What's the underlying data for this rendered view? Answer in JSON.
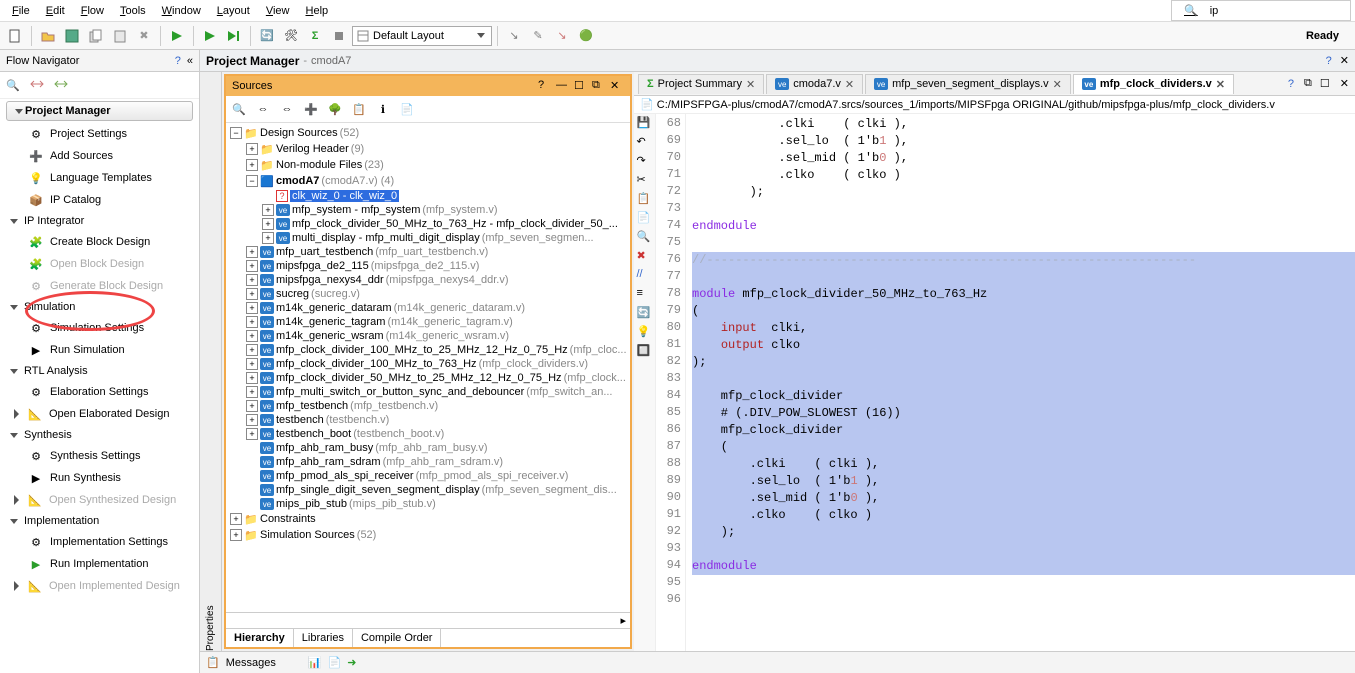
{
  "menu": {
    "items": [
      "File",
      "Edit",
      "Flow",
      "Tools",
      "Window",
      "Layout",
      "View",
      "Help"
    ]
  },
  "search": {
    "placeholder": "",
    "value": "ip"
  },
  "toolbar": {
    "layout_label": "Default Layout",
    "status": "Ready"
  },
  "flow_nav": {
    "title": "Flow Navigator",
    "pm": "Project Manager",
    "pm_items": [
      "Project Settings",
      "Add Sources",
      "Language Templates",
      "IP Catalog"
    ],
    "ip": "IP Integrator",
    "ip_items": [
      "Create Block Design",
      "Open Block Design",
      "Generate Block Design"
    ],
    "sim": "Simulation",
    "sim_items": [
      "Simulation Settings",
      "Run Simulation"
    ],
    "rtl": "RTL Analysis",
    "rtl_items": [
      "Elaboration Settings",
      "Open Elaborated Design"
    ],
    "syn": "Synthesis",
    "syn_items": [
      "Synthesis Settings",
      "Run Synthesis",
      "Open Synthesized Design"
    ],
    "impl": "Implementation",
    "impl_items": [
      "Implementation Settings",
      "Run Implementation",
      "Open Implemented Design"
    ]
  },
  "pm_header": {
    "title": "Project Manager",
    "project": "cmodA7"
  },
  "properties_tab": "Properties",
  "sources": {
    "title": "Sources",
    "bottom_tabs": [
      "Hierarchy",
      "Libraries",
      "Compile Order"
    ],
    "tree": {
      "design_sources": "Design Sources",
      "design_sources_count": "(52)",
      "verilog_header": "Verilog Header",
      "verilog_header_count": "(9)",
      "non_module": "Non-module Files",
      "non_module_count": "(23)",
      "cmodA7": "cmodA7",
      "cmodA7_paren": "(cmodA7.v) (4)",
      "clk_wiz": "clk_wiz_0 - clk_wiz_0",
      "mfp_system": "mfp_system - mfp_system",
      "mfp_system_paren": "(mfp_system.v)",
      "mfp_clock_div": "mfp_clock_divider_50_MHz_to_763_Hz - mfp_clock_divider_50_...",
      "multi_display": "multi_display - mfp_multi_digit_display",
      "multi_display_paren": "(mfp_seven_segmen...",
      "uart_tb": "mfp_uart_testbench",
      "uart_tb_paren": "(mfp_uart_testbench.v)",
      "de2": "mipsfpga_de2_115",
      "de2_paren": "(mipsfpga_de2_115.v)",
      "nexys4": "mipsfpga_nexys4_ddr",
      "nexys4_paren": "(mipsfpga_nexys4_ddr.v)",
      "sucreg": "sucreg",
      "sucreg_paren": "(sucreg.v)",
      "dataram": "m14k_generic_dataram",
      "dataram_paren": "(m14k_generic_dataram.v)",
      "tagram": "m14k_generic_tagram",
      "tagram_paren": "(m14k_generic_tagram.v)",
      "wsram": "m14k_generic_wsram",
      "wsram_paren": "(m14k_generic_wsram.v)",
      "clk100_25": "mfp_clock_divider_100_MHz_to_25_MHz_12_Hz_0_75_Hz",
      "clk100_25_paren": "(mfp_cloc...",
      "clk100_763": "mfp_clock_divider_100_MHz_to_763_Hz",
      "clk100_763_paren": "(mfp_clock_dividers.v)",
      "clk50_25": "mfp_clock_divider_50_MHz_to_25_MHz_12_Hz_0_75_Hz",
      "clk50_25_paren": "(mfp_clock...",
      "switch": "mfp_multi_switch_or_button_sync_and_debouncer",
      "switch_paren": "(mfp_switch_an...",
      "mfp_tb": "mfp_testbench",
      "mfp_tb_paren": "(mfp_testbench.v)",
      "tb": "testbench",
      "tb_paren": "(testbench.v)",
      "tb_boot": "testbench_boot",
      "tb_boot_paren": "(testbench_boot.v)",
      "ahb_busy": "mfp_ahb_ram_busy",
      "ahb_busy_paren": "(mfp_ahb_ram_busy.v)",
      "ahb_sdram": "mfp_ahb_ram_sdram",
      "ahb_sdram_paren": "(mfp_ahb_ram_sdram.v)",
      "pmod": "mfp_pmod_als_spi_receiver",
      "pmod_paren": "(mfp_pmod_als_spi_receiver.v)",
      "seven_seg": "mfp_single_digit_seven_segment_display",
      "seven_seg_paren": "(mfp_seven_segment_dis...",
      "pib": "mips_pib_stub",
      "pib_paren": "(mips_pib_stub.v)",
      "constraints": "Constraints",
      "sim_sources": "Simulation Sources",
      "sim_sources_count": "(52)"
    }
  },
  "editor": {
    "tabs": [
      {
        "label": "Project Summary",
        "icon": "Σ",
        "active": false
      },
      {
        "label": "cmoda7.v",
        "icon": "ve",
        "active": false
      },
      {
        "label": "mfp_seven_segment_displays.v",
        "icon": "ve",
        "active": false
      },
      {
        "label": "mfp_clock_dividers.v",
        "icon": "ve",
        "active": true
      }
    ],
    "filepath": "C:/MIPSFPGA-plus/cmodA7/cmodA7.srcs/sources_1/imports/MIPSFpga ORIGINAL/github/mipsfpga-plus/mfp_clock_dividers.v",
    "first_line": 68,
    "lines": [
      "            .clki    ( clki ),",
      "            .sel_lo  ( 1'b1 ),",
      "            .sel_mid ( 1'b0 ),",
      "            .clko    ( clko )",
      "        );",
      "",
      "endmodule",
      "",
      "//--------------------------------------------------------------------",
      "",
      "module mfp_clock_divider_50_MHz_to_763_Hz",
      "(",
      "    input  clki,",
      "    output clko",
      ");",
      "",
      "    mfp_clock_divider",
      "    # (.DIV_POW_SLOWEST (16))",
      "    mfp_clock_divider",
      "    (",
      "        .clki    ( clki ),",
      "        .sel_lo  ( 1'b1 ),",
      "        .sel_mid ( 1'b0 ),",
      "        .clko    ( clko )",
      "    );",
      "",
      "endmodule",
      "",
      ""
    ],
    "highlight_start": 76,
    "highlight_end": 94
  },
  "messages_tab": "Messages"
}
